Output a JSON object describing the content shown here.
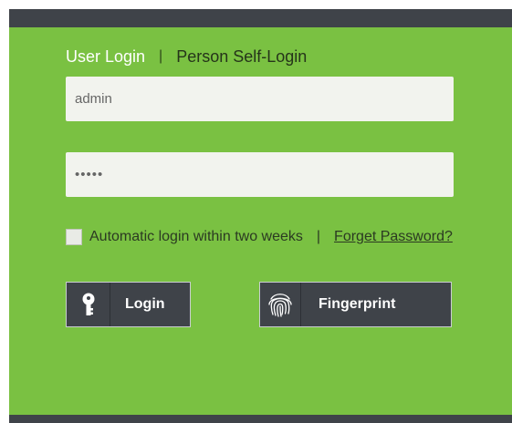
{
  "tabs": {
    "user_login": "User Login",
    "separator": "|",
    "person_self_login": "Person Self-Login"
  },
  "form": {
    "username_value": "admin",
    "password_masked": "•••••",
    "auto_login_label": "Automatic login within two weeks",
    "options_separator": "|",
    "forget_password": "Forget Password?"
  },
  "buttons": {
    "login_label": "Login",
    "login_icon": "key-icon",
    "fingerprint_label": "Fingerprint",
    "fingerprint_icon": "fingerprint-icon"
  },
  "colors": {
    "panel_green": "#7ac142",
    "bar_dark": "#3f4349",
    "field_bg": "#f2f3ee"
  }
}
